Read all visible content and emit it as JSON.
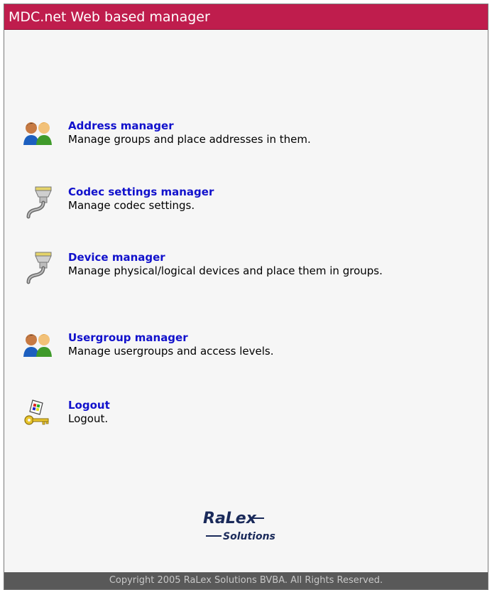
{
  "header": {
    "title": "MDC.net Web based manager"
  },
  "menu": [
    {
      "label": "Address manager",
      "description": "Manage groups and place addresses in them.",
      "icon": "users-icon"
    },
    {
      "label": "Codec settings manager",
      "description": "Manage codec settings.",
      "icon": "connector-cable-icon"
    },
    {
      "label": "Device manager",
      "description": "Manage physical/logical devices and place them in groups.",
      "icon": "connector-cable-icon"
    },
    {
      "label": "Usergroup manager",
      "description": "Manage usergroups and access levels.",
      "icon": "users-icon"
    },
    {
      "label": "Logout",
      "description": "Logout.",
      "icon": "key-icon"
    }
  ],
  "logo": {
    "line1": "RaLex",
    "line2": "Solutions"
  },
  "footer": {
    "copyright": "Copyright 2005 RaLex Solutions BVBA. All Rights Reserved."
  },
  "colors": {
    "titlebar": "#bf1d4d",
    "link": "#1111cc",
    "footer": "#595959"
  }
}
